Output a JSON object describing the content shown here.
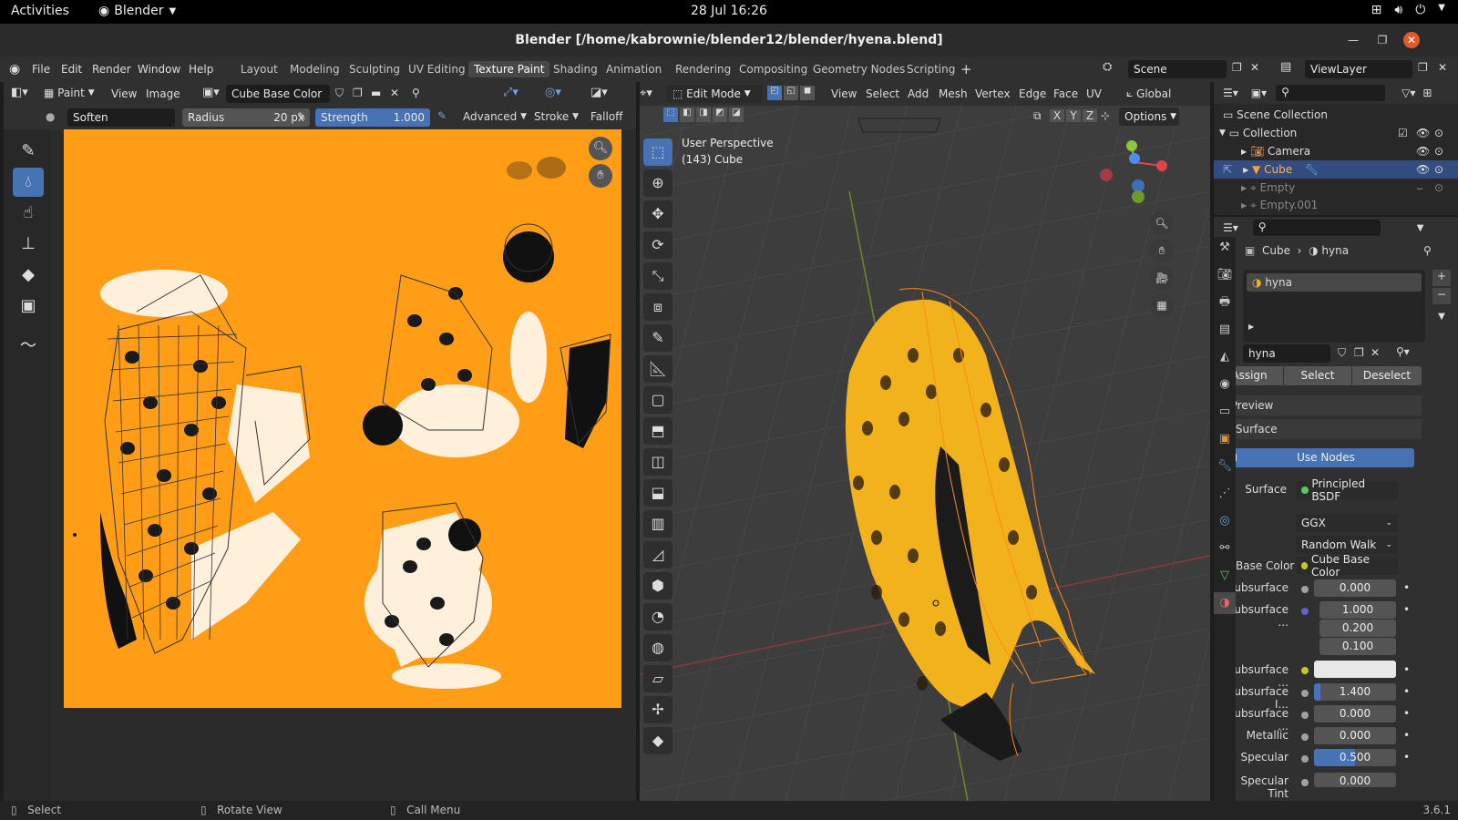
{
  "gnome": {
    "activities": "Activities",
    "app": "Blender",
    "clock": "28 Jul  16:26"
  },
  "window": {
    "title": "Blender [/home/kabrownie/blender12/blender/hyena.blend]"
  },
  "menu": {
    "items": [
      "File",
      "Edit",
      "Render",
      "Window",
      "Help"
    ]
  },
  "workspaces": [
    "Layout",
    "Modeling",
    "Sculpting",
    "UV Editing",
    "Texture Paint",
    "Shading",
    "Animation",
    "Rendering",
    "Compositing",
    "Geometry Nodes",
    "Scripting"
  ],
  "active_workspace": "Texture Paint",
  "scene": {
    "name": "Scene",
    "view_layer": "ViewLayer"
  },
  "image_editor": {
    "mode": "Paint",
    "view": "View",
    "image": "Image",
    "image_name": "Cube Base Color",
    "brush": "Soften",
    "radius_label": "Radius",
    "radius_value": "20 px",
    "strength_label": "Strength",
    "strength_value": "1.000",
    "strength_fill": 1.0,
    "advanced": "Advanced",
    "stroke": "Stroke",
    "falloff": "Falloff"
  },
  "viewport": {
    "mode": "Edit Mode",
    "menus": [
      "View",
      "Select",
      "Add",
      "Mesh",
      "Vertex",
      "Edge",
      "Face",
      "UV"
    ],
    "orientation": "Global",
    "options": "Options",
    "axes": [
      "X",
      "Y",
      "Z"
    ],
    "info_line1": "User Perspective",
    "info_line2": "(143) Cube"
  },
  "outliner": {
    "root": "Scene Collection",
    "collection": "Collection",
    "items": [
      {
        "name": "Camera"
      },
      {
        "name": "Cube"
      },
      {
        "name": "Empty"
      },
      {
        "name": "Empty.001"
      }
    ]
  },
  "properties": {
    "breadcrumb_obj": "Cube",
    "breadcrumb_mat": "hyna",
    "slot": "hyna",
    "material": "hyna",
    "assign": "Assign",
    "select": "Select",
    "deselect": "Deselect",
    "preview": "Preview",
    "surface_panel": "Surface",
    "use_nodes": "Use Nodes",
    "surface_label": "Surface",
    "surface_value": "Principled BSDF",
    "distribution": "GGX",
    "subsurface_method": "Random Walk",
    "rows": [
      {
        "label": "Base Color",
        "value": "Cube Base Color",
        "kind": "link"
      },
      {
        "label": "Subsurface",
        "value": "0.000",
        "kind": "num"
      },
      {
        "label": "Subsurface ...",
        "values": [
          "1.000",
          "0.200",
          "0.100"
        ],
        "kind": "vec"
      },
      {
        "label": "Subsurface ...",
        "value": "",
        "kind": "color"
      },
      {
        "label": "Subsurface I...",
        "value": "1.400",
        "kind": "num"
      },
      {
        "label": "Subsurface ...",
        "value": "0.000",
        "kind": "num"
      },
      {
        "label": "Metallic",
        "value": "0.000",
        "kind": "num"
      },
      {
        "label": "Specular",
        "value": "0.500",
        "kind": "sel"
      },
      {
        "label": "Specular Tint",
        "value": "0.000",
        "kind": "num"
      }
    ]
  },
  "status": {
    "select": "Select",
    "rotate": "Rotate View",
    "call_menu": "Call Menu",
    "version": "3.6.1"
  },
  "colors": {
    "accent": "#4772b3",
    "texture_orange": "#ff9d17",
    "close_orange": "#e05a2b"
  }
}
